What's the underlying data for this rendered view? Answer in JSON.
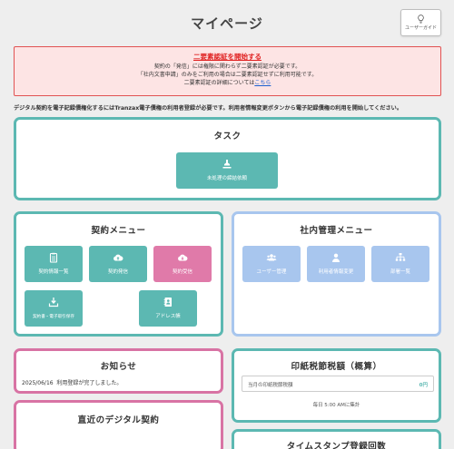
{
  "header": {
    "title": "マイページ",
    "guide_label": "ユーザーガイド"
  },
  "alert": {
    "title": "二要素認証を開始する",
    "line1": "契約の「発信」には権限に関わらず二要素認証が必要です。",
    "line2": "「社内文書申請」のみをご利用の場合は二要素認証せずに利用可能です。",
    "line3_prefix": "二要素認証の詳細については",
    "line3_link": "こちら"
  },
  "notice": "デジタル契約を電子記録債権化するにはTranzax電子債権の利用者登録が必要です。利用者情報変更ボタンから電子記録債権の利用を開始してください。",
  "task": {
    "title": "タスク",
    "button": "未処理の締結依頼"
  },
  "contract_menu": {
    "title": "契約メニュー",
    "items": [
      "契約情報一覧",
      "契約発信",
      "契約受信",
      "契約書・電子取引保存",
      "アドレス帳"
    ]
  },
  "internal_menu": {
    "title": "社内管理メニュー",
    "items": [
      "ユーザー管理",
      "利用者情報変更",
      "部署一覧"
    ]
  },
  "news": {
    "title": "お知らせ",
    "items": [
      {
        "date": "2025/06/16",
        "text": "利用登録が完了しました。"
      }
    ]
  },
  "stamp_tax": {
    "title": "印紙税節税額（概算）",
    "label": "当月の印紙税節税額",
    "value": "0円",
    "note": "毎日 5:00 AMに集計"
  },
  "recent": {
    "title": "直近のデジタル契約"
  },
  "timestamp": {
    "title": "タイムスタンプ登録回数"
  },
  "colors": {
    "teal": "#5cb8b2",
    "pink": "#d873a4",
    "blue": "#a8c6ee",
    "alert_red": "#e02020"
  }
}
